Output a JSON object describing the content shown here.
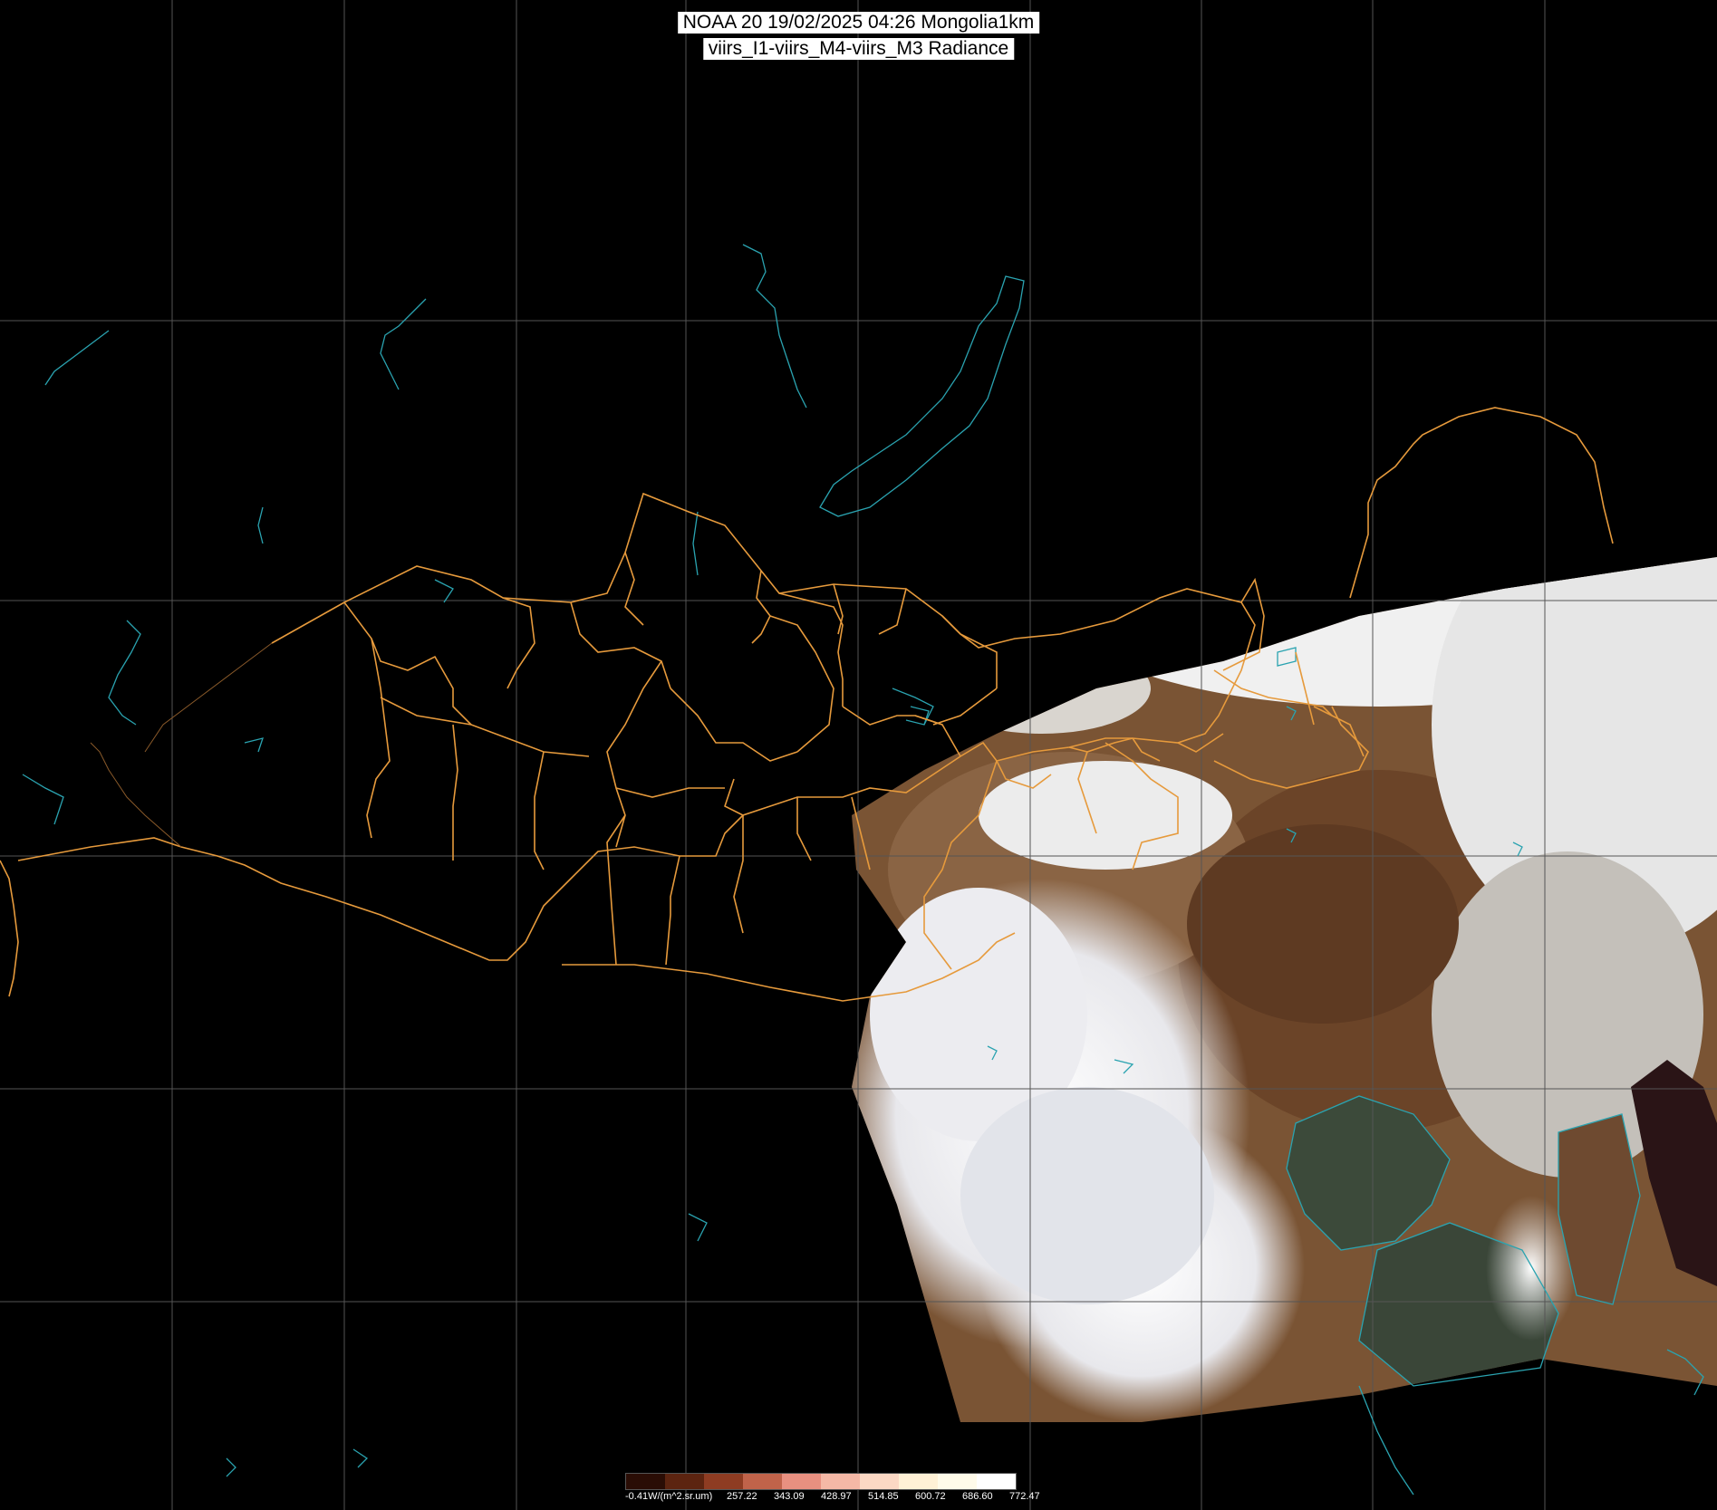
{
  "title": {
    "line1": "NOAA 20 19/02/2025 04:26 Mongolia1km",
    "line2": "viirs_I1-viirs_M4-viirs_M3 Radiance"
  },
  "legend": {
    "unit_label": "-0.41W/(m^2.sr.um)",
    "ticks": [
      "257.22",
      "343.09",
      "428.97",
      "514.85",
      "600.72",
      "686.60",
      "772.47"
    ],
    "colors": [
      "#2a0d05",
      "#5c2410",
      "#8e3c22",
      "#c0634a",
      "#e89080",
      "#f4b8a6",
      "#fbd8c4",
      "#fff1d6",
      "#fffbea",
      "#ffffff"
    ]
  },
  "colors": {
    "background": "#000000",
    "graticule": "#555555",
    "borders": "#e69a3c",
    "coastlines": "#2aa3b0",
    "snow": "#f2f2f2",
    "land": "#7a5232",
    "sea": "#3a4a3c"
  }
}
